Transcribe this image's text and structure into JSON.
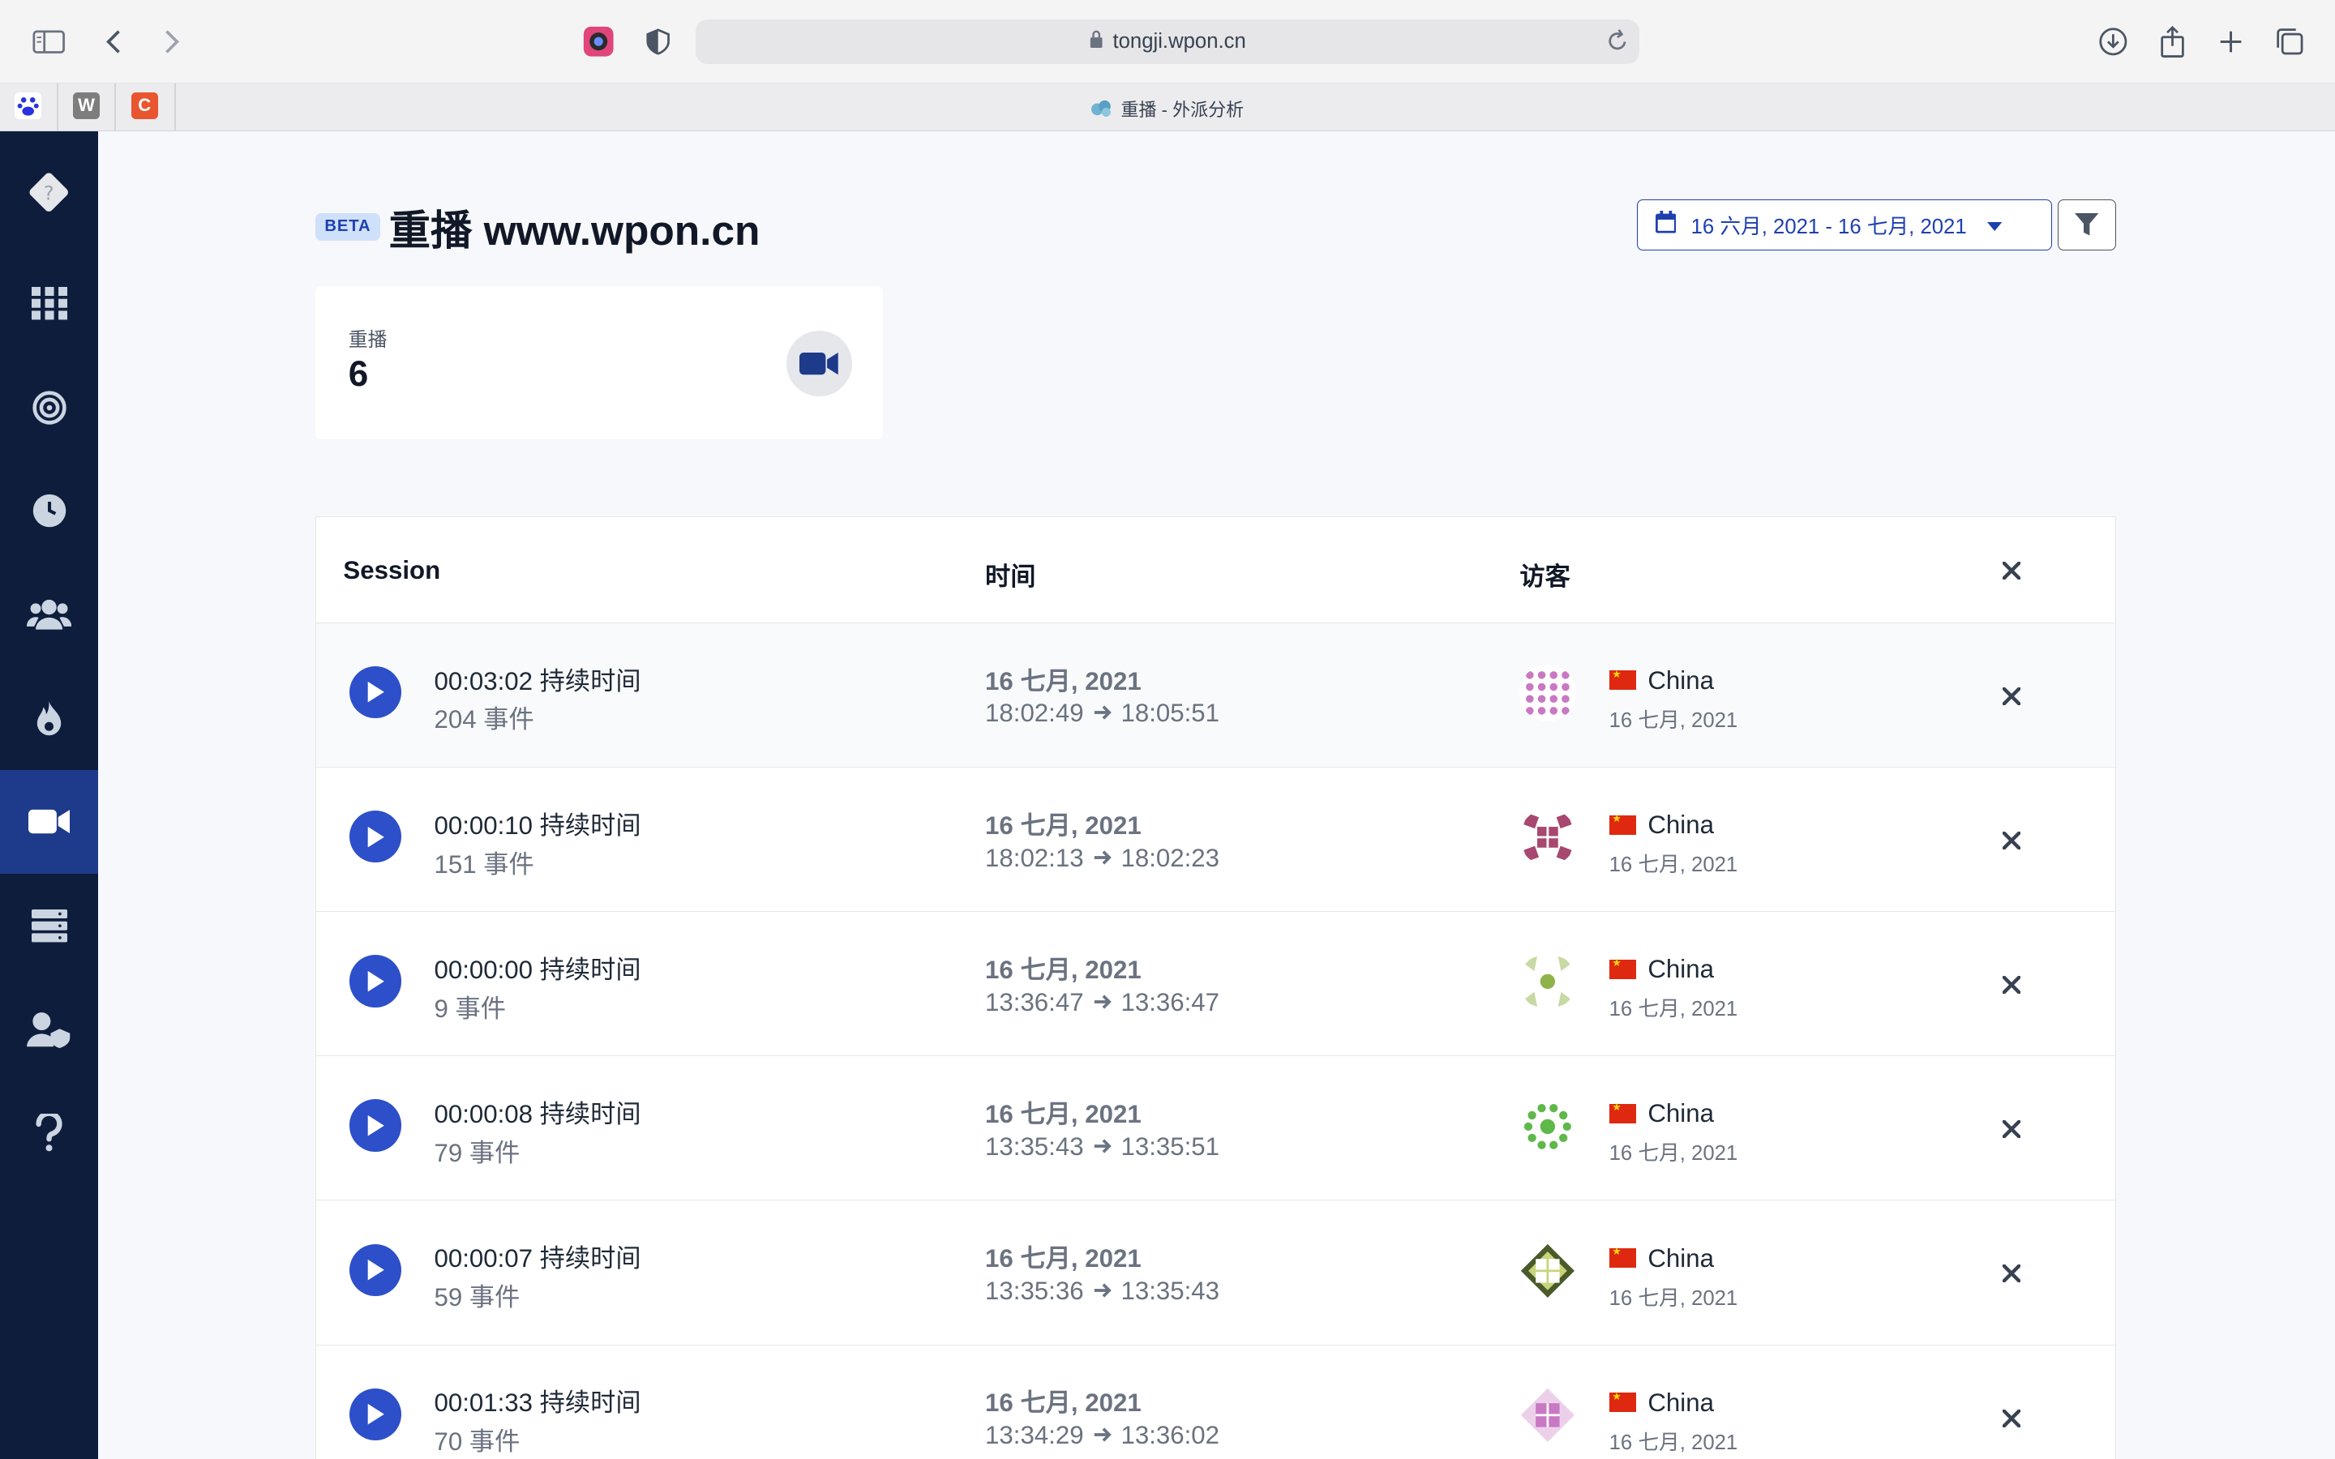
{
  "browser": {
    "url": "tongji.wpon.cn",
    "tab_title": "重播 - 外派分析"
  },
  "sidebar": {
    "items": [
      {
        "name": "dashboard",
        "icon": "grid-icon",
        "active": false
      },
      {
        "name": "goals",
        "icon": "target-icon",
        "active": false
      },
      {
        "name": "realtime",
        "icon": "clock-icon",
        "active": false
      },
      {
        "name": "visitors",
        "icon": "users-icon",
        "active": false
      },
      {
        "name": "heatmaps",
        "icon": "flame-icon",
        "active": false
      },
      {
        "name": "replays",
        "icon": "video-icon",
        "active": true
      },
      {
        "name": "websites",
        "icon": "server-icon",
        "active": false
      },
      {
        "name": "team",
        "icon": "user-shield-icon",
        "active": false
      },
      {
        "name": "help",
        "icon": "question-icon",
        "active": false
      }
    ]
  },
  "header": {
    "badge": "BETA",
    "title": "重播 www.wpon.cn",
    "date_range": "16 六月, 2021 - 16 七月, 2021"
  },
  "stat": {
    "label": "重播",
    "value": "6"
  },
  "table": {
    "headers": {
      "session": "Session",
      "time": "时间",
      "visitor": "访客"
    },
    "rows": [
      {
        "duration": "00:03:02 持续时间",
        "events": "204 事件",
        "date": "16 七月, 2021",
        "start": "18:02:49",
        "end": "18:05:51",
        "country": "China",
        "visit_date": "16 七月, 2021",
        "avatar_color": "#c978c4"
      },
      {
        "duration": "00:00:10 持续时间",
        "events": "151 事件",
        "date": "16 七月, 2021",
        "start": "18:02:13",
        "end": "18:02:23",
        "country": "China",
        "visit_date": "16 七月, 2021",
        "avatar_color": "#a8476f"
      },
      {
        "duration": "00:00:00 持续时间",
        "events": "9 事件",
        "date": "16 七月, 2021",
        "start": "13:36:47",
        "end": "13:36:47",
        "country": "China",
        "visit_date": "16 七月, 2021",
        "avatar_color": "#8fb34a"
      },
      {
        "duration": "00:00:08 持续时间",
        "events": "79 事件",
        "date": "16 七月, 2021",
        "start": "13:35:43",
        "end": "13:35:51",
        "country": "China",
        "visit_date": "16 七月, 2021",
        "avatar_color": "#5fb84a"
      },
      {
        "duration": "00:00:07 持续时间",
        "events": "59 事件",
        "date": "16 七月, 2021",
        "start": "13:35:36",
        "end": "13:35:43",
        "country": "China",
        "visit_date": "16 七月, 2021",
        "avatar_color": "#4a5a2a"
      },
      {
        "duration": "00:01:33 持续时间",
        "events": "70 事件",
        "date": "16 七月, 2021",
        "start": "13:34:29",
        "end": "13:36:02",
        "country": "China",
        "visit_date": "16 七月, 2021",
        "avatar_color": "#c978c4"
      }
    ]
  },
  "colors": {
    "sidebar_bg": "#0f1d3d",
    "sidebar_active": "#1e3a8a",
    "accent": "#2d4fc9",
    "flag_red": "#de2910"
  }
}
